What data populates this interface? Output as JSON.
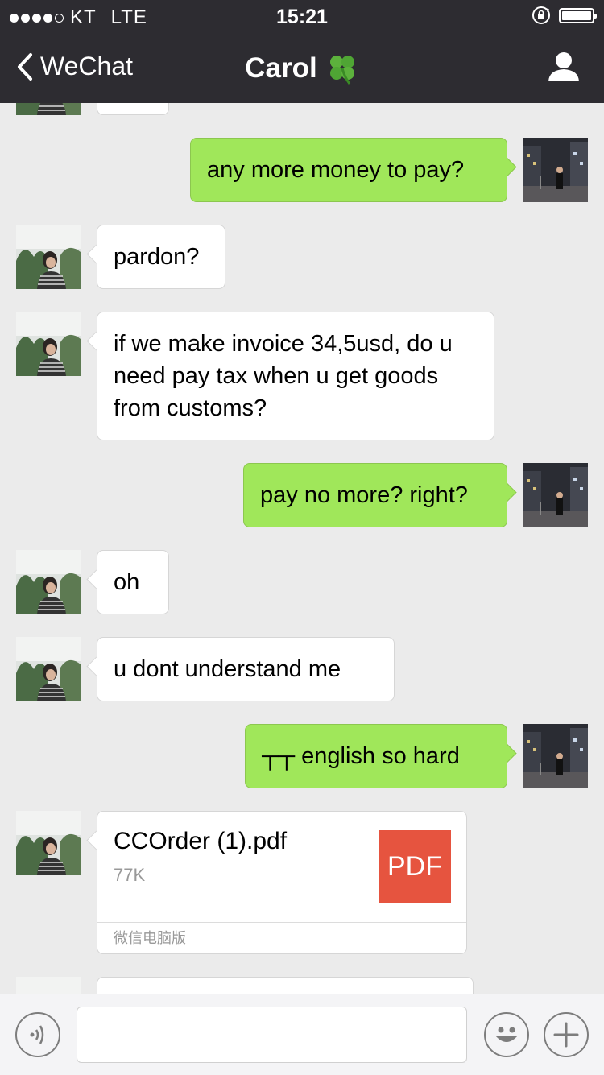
{
  "status_bar": {
    "carrier": "KT",
    "network": "LTE",
    "time": "15:21",
    "signal_bars_filled": 4,
    "signal_bars_total": 5,
    "battery_level": 1.0
  },
  "nav": {
    "back_label": "WeChat",
    "title": "Carol",
    "title_emoji": "🍀"
  },
  "messages": [
    {
      "direction": "out",
      "text": "any more money to pay?"
    },
    {
      "direction": "in",
      "text": "pardon?"
    },
    {
      "direction": "in",
      "text": "if we make invoice 34,5usd, do u need pay tax when u get goods from customs?"
    },
    {
      "direction": "out",
      "text": "pay no more? right?"
    },
    {
      "direction": "in",
      "text": "oh"
    },
    {
      "direction": "in",
      "text": "u dont understand me"
    },
    {
      "direction": "out",
      "text": "┬┬ english so hard"
    }
  ],
  "file_message": {
    "direction": "in",
    "file_name": "CCOrder (1).pdf",
    "file_size": "77K",
    "badge": "PDF",
    "source": "微信电脑版"
  },
  "input_bar": {
    "voice_icon": "voice-icon",
    "emoji_icon": "emoji-icon",
    "plus_icon": "plus-icon"
  },
  "colors": {
    "nav_bg": "#2d2c31",
    "chat_bg": "#ebebeb",
    "outgoing_bubble": "#a0e75a",
    "incoming_bubble": "#ffffff",
    "pdf_badge": "#e6543f"
  }
}
